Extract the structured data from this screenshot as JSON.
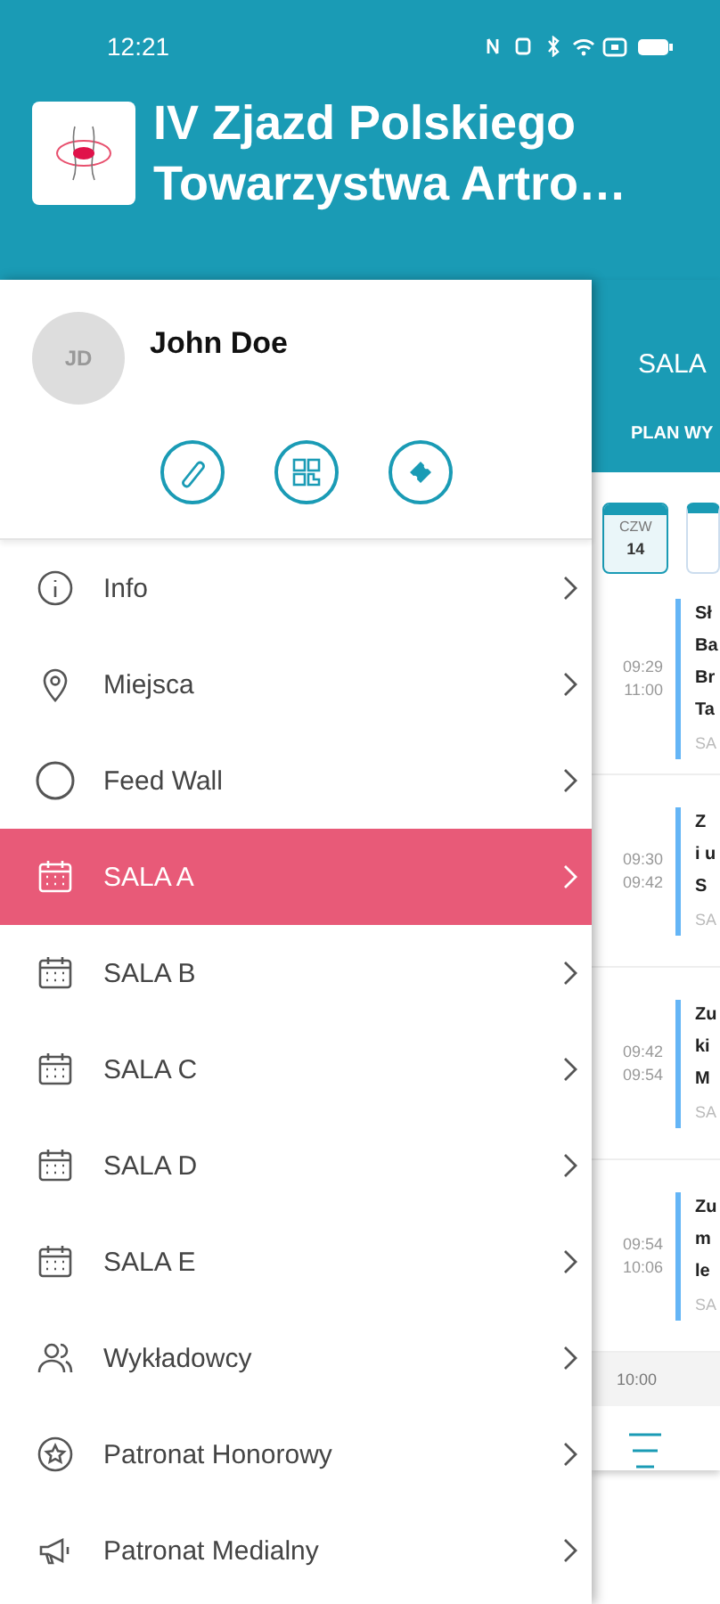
{
  "status_bar": {
    "time": "12:21"
  },
  "app_title": [
    "IV Zjazd Polskiego",
    "Towarzystwa Artro…"
  ],
  "profile": {
    "initials": "JD",
    "name": "John Doe"
  },
  "profile_actions": [
    {
      "kind": "edit"
    },
    {
      "kind": "qr"
    },
    {
      "kind": "ticket"
    }
  ],
  "menu": [
    {
      "label": "Info",
      "kind": "info",
      "selected": false
    },
    {
      "label": "Miejsca",
      "kind": "pin",
      "selected": false
    },
    {
      "label": "Feed Wall",
      "kind": "circle",
      "selected": false
    },
    {
      "label": "SALA A",
      "kind": "calendar",
      "selected": true
    },
    {
      "label": "SALA B",
      "kind": "calendar",
      "selected": false
    },
    {
      "label": "SALA C",
      "kind": "calendar",
      "selected": false
    },
    {
      "label": "SALA D",
      "kind": "calendar",
      "selected": false
    },
    {
      "label": "SALA E",
      "kind": "calendar",
      "selected": false
    },
    {
      "label": "Wykładowcy",
      "kind": "people",
      "selected": false
    },
    {
      "label": "Patronat Honorowy",
      "kind": "badge",
      "selected": false
    },
    {
      "label": "Patronat Medialny",
      "kind": "megaphone",
      "selected": false
    }
  ],
  "background_screen": {
    "title": "SALA",
    "tab": "PLAN WY",
    "day": {
      "weekday": "CZW",
      "date": "14",
      "selected": true
    },
    "sessions": [
      {
        "start": "09:29",
        "end": "11:00",
        "lines": [
          "Sł",
          "Ba",
          "Br",
          "Ta"
        ],
        "room": "SA"
      },
      {
        "start": "09:30",
        "end": "09:42",
        "lines": [
          "Z",
          "i u",
          "S"
        ],
        "room": "SA"
      },
      {
        "start": "09:42",
        "end": "09:54",
        "lines": [
          "Zu",
          "ki",
          "M"
        ],
        "room": "SA"
      },
      {
        "start": "09:54",
        "end": "10:06",
        "lines": [
          "Zu",
          "m",
          "le"
        ],
        "room": "SA"
      }
    ],
    "hour": "10:00"
  }
}
